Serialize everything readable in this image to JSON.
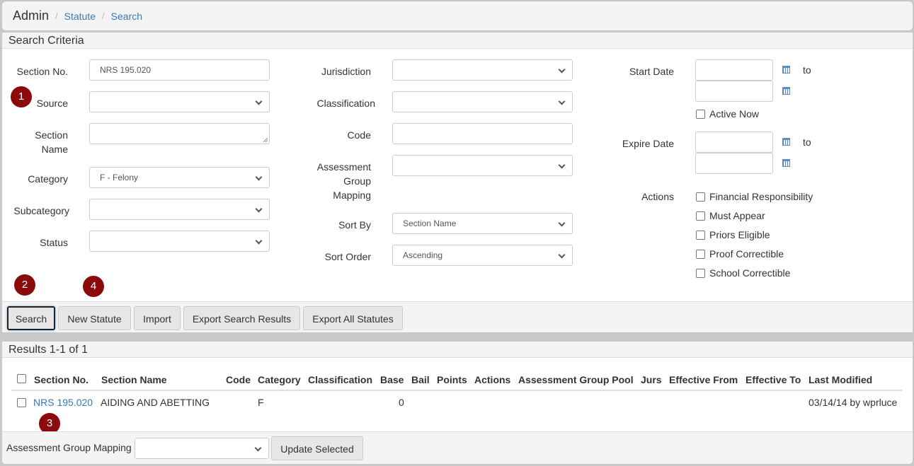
{
  "breadcrumb": {
    "title": "Admin",
    "items": [
      "Statute",
      "Search"
    ]
  },
  "criteria": {
    "heading": "Search Criteria",
    "col1": {
      "section_no": {
        "label": "Section No.",
        "value": "NRS 195.020"
      },
      "source": {
        "label": "Source",
        "value": ""
      },
      "section_name": {
        "label_line1": "Section",
        "label_line2": "Name",
        "value": ""
      },
      "category": {
        "label": "Category",
        "value": "F - Felony"
      },
      "subcategory": {
        "label": "Subcategory",
        "value": ""
      },
      "status": {
        "label": "Status",
        "value": ""
      }
    },
    "col2": {
      "jurisdiction": {
        "label": "Jurisdiction",
        "value": ""
      },
      "classification": {
        "label": "Classification",
        "value": ""
      },
      "code": {
        "label": "Code",
        "value": ""
      },
      "assessment": {
        "label_line1": "Assessment",
        "label_line2": "Group",
        "label_line3": "Mapping",
        "value": ""
      },
      "sort_by": {
        "label": "Sort By",
        "value": "Section Name"
      },
      "sort_order": {
        "label": "Sort Order",
        "value": "Ascending"
      }
    },
    "col3": {
      "start_date": {
        "label": "Start Date",
        "from": "",
        "to": "",
        "to_label": "to"
      },
      "active_now": {
        "label": "Active Now",
        "checked": false
      },
      "expire_date": {
        "label": "Expire Date",
        "from": "",
        "to": "",
        "to_label": "to"
      },
      "actions_label": "Actions",
      "actions": [
        {
          "label": "Financial Responsibility",
          "checked": false
        },
        {
          "label": "Must Appear",
          "checked": false
        },
        {
          "label": "Priors Eligible",
          "checked": false
        },
        {
          "label": "Proof Correctible",
          "checked": false
        },
        {
          "label": "School Correctible",
          "checked": false
        }
      ]
    },
    "buttons": {
      "search": "Search",
      "new_statute": "New Statute",
      "import": "Import",
      "export_results": "Export Search Results",
      "export_all": "Export All Statutes"
    }
  },
  "badges": [
    "1",
    "2",
    "3",
    "4"
  ],
  "results": {
    "heading": "Results 1-1 of 1",
    "columns": [
      "Section No.",
      "Section Name",
      "Code",
      "Category",
      "Classification",
      "Base",
      "Bail",
      "Points",
      "Actions",
      "Assessment Group Pool",
      "Jurs",
      "Effective From",
      "Effective To",
      "Last Modified"
    ],
    "rows": [
      {
        "section_no": "NRS 195.020",
        "section_name": "AIDING AND ABETTING",
        "code": "",
        "category": "F",
        "classification": "",
        "base": "0",
        "bail": "",
        "points": "",
        "actions": "",
        "pool": "",
        "jurs": "",
        "eff_from": "",
        "eff_to": "",
        "last_modified": "03/14/14 by wprluce"
      }
    ],
    "footer": {
      "mapping_label": "Assessment Group Mapping",
      "mapping_value": "",
      "update_button": "Update Selected"
    }
  }
}
